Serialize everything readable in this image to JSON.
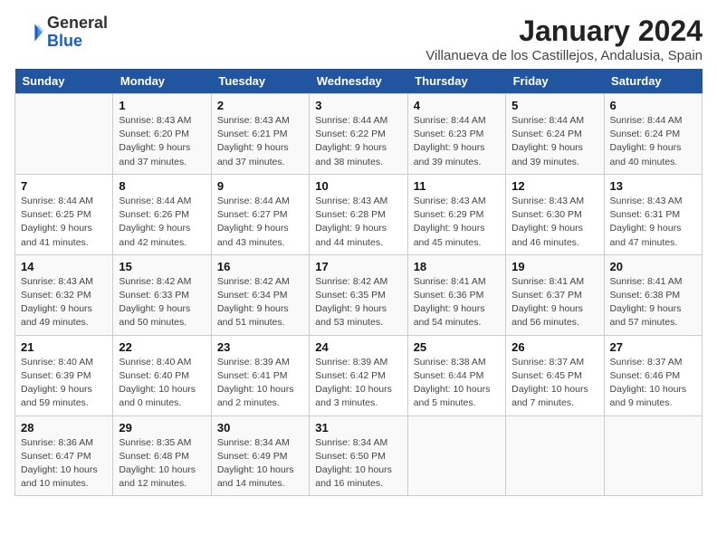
{
  "header": {
    "logo_general": "General",
    "logo_blue": "Blue",
    "month_title": "January 2024",
    "subtitle": "Villanueva de los Castillejos, Andalusia, Spain"
  },
  "days_of_week": [
    "Sunday",
    "Monday",
    "Tuesday",
    "Wednesday",
    "Thursday",
    "Friday",
    "Saturday"
  ],
  "weeks": [
    [
      {
        "day": "",
        "info": ""
      },
      {
        "day": "1",
        "info": "Sunrise: 8:43 AM\nSunset: 6:20 PM\nDaylight: 9 hours\nand 37 minutes."
      },
      {
        "day": "2",
        "info": "Sunrise: 8:43 AM\nSunset: 6:21 PM\nDaylight: 9 hours\nand 37 minutes."
      },
      {
        "day": "3",
        "info": "Sunrise: 8:44 AM\nSunset: 6:22 PM\nDaylight: 9 hours\nand 38 minutes."
      },
      {
        "day": "4",
        "info": "Sunrise: 8:44 AM\nSunset: 6:23 PM\nDaylight: 9 hours\nand 39 minutes."
      },
      {
        "day": "5",
        "info": "Sunrise: 8:44 AM\nSunset: 6:24 PM\nDaylight: 9 hours\nand 39 minutes."
      },
      {
        "day": "6",
        "info": "Sunrise: 8:44 AM\nSunset: 6:24 PM\nDaylight: 9 hours\nand 40 minutes."
      }
    ],
    [
      {
        "day": "7",
        "info": "Sunrise: 8:44 AM\nSunset: 6:25 PM\nDaylight: 9 hours\nand 41 minutes."
      },
      {
        "day": "8",
        "info": "Sunrise: 8:44 AM\nSunset: 6:26 PM\nDaylight: 9 hours\nand 42 minutes."
      },
      {
        "day": "9",
        "info": "Sunrise: 8:44 AM\nSunset: 6:27 PM\nDaylight: 9 hours\nand 43 minutes."
      },
      {
        "day": "10",
        "info": "Sunrise: 8:43 AM\nSunset: 6:28 PM\nDaylight: 9 hours\nand 44 minutes."
      },
      {
        "day": "11",
        "info": "Sunrise: 8:43 AM\nSunset: 6:29 PM\nDaylight: 9 hours\nand 45 minutes."
      },
      {
        "day": "12",
        "info": "Sunrise: 8:43 AM\nSunset: 6:30 PM\nDaylight: 9 hours\nand 46 minutes."
      },
      {
        "day": "13",
        "info": "Sunrise: 8:43 AM\nSunset: 6:31 PM\nDaylight: 9 hours\nand 47 minutes."
      }
    ],
    [
      {
        "day": "14",
        "info": "Sunrise: 8:43 AM\nSunset: 6:32 PM\nDaylight: 9 hours\nand 49 minutes."
      },
      {
        "day": "15",
        "info": "Sunrise: 8:42 AM\nSunset: 6:33 PM\nDaylight: 9 hours\nand 50 minutes."
      },
      {
        "day": "16",
        "info": "Sunrise: 8:42 AM\nSunset: 6:34 PM\nDaylight: 9 hours\nand 51 minutes."
      },
      {
        "day": "17",
        "info": "Sunrise: 8:42 AM\nSunset: 6:35 PM\nDaylight: 9 hours\nand 53 minutes."
      },
      {
        "day": "18",
        "info": "Sunrise: 8:41 AM\nSunset: 6:36 PM\nDaylight: 9 hours\nand 54 minutes."
      },
      {
        "day": "19",
        "info": "Sunrise: 8:41 AM\nSunset: 6:37 PM\nDaylight: 9 hours\nand 56 minutes."
      },
      {
        "day": "20",
        "info": "Sunrise: 8:41 AM\nSunset: 6:38 PM\nDaylight: 9 hours\nand 57 minutes."
      }
    ],
    [
      {
        "day": "21",
        "info": "Sunrise: 8:40 AM\nSunset: 6:39 PM\nDaylight: 9 hours\nand 59 minutes."
      },
      {
        "day": "22",
        "info": "Sunrise: 8:40 AM\nSunset: 6:40 PM\nDaylight: 10 hours\nand 0 minutes."
      },
      {
        "day": "23",
        "info": "Sunrise: 8:39 AM\nSunset: 6:41 PM\nDaylight: 10 hours\nand 2 minutes."
      },
      {
        "day": "24",
        "info": "Sunrise: 8:39 AM\nSunset: 6:42 PM\nDaylight: 10 hours\nand 3 minutes."
      },
      {
        "day": "25",
        "info": "Sunrise: 8:38 AM\nSunset: 6:44 PM\nDaylight: 10 hours\nand 5 minutes."
      },
      {
        "day": "26",
        "info": "Sunrise: 8:37 AM\nSunset: 6:45 PM\nDaylight: 10 hours\nand 7 minutes."
      },
      {
        "day": "27",
        "info": "Sunrise: 8:37 AM\nSunset: 6:46 PM\nDaylight: 10 hours\nand 9 minutes."
      }
    ],
    [
      {
        "day": "28",
        "info": "Sunrise: 8:36 AM\nSunset: 6:47 PM\nDaylight: 10 hours\nand 10 minutes."
      },
      {
        "day": "29",
        "info": "Sunrise: 8:35 AM\nSunset: 6:48 PM\nDaylight: 10 hours\nand 12 minutes."
      },
      {
        "day": "30",
        "info": "Sunrise: 8:34 AM\nSunset: 6:49 PM\nDaylight: 10 hours\nand 14 minutes."
      },
      {
        "day": "31",
        "info": "Sunrise: 8:34 AM\nSunset: 6:50 PM\nDaylight: 10 hours\nand 16 minutes."
      },
      {
        "day": "",
        "info": ""
      },
      {
        "day": "",
        "info": ""
      },
      {
        "day": "",
        "info": ""
      }
    ]
  ]
}
